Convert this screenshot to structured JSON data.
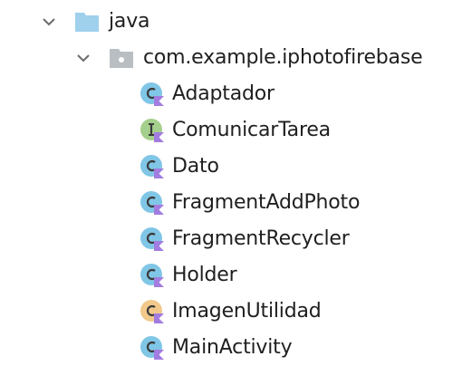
{
  "tree": {
    "java_folder": {
      "label": "java",
      "icon": "folder-icon",
      "color": "#9fd0ec",
      "expanded": true
    },
    "package": {
      "label": "com.example.iphotofirebase",
      "icon": "package-folder-icon",
      "color": "#b9bec3",
      "expanded": true
    },
    "classes": [
      {
        "label": "Adaptador",
        "icon": "kotlin-class-icon",
        "color": "#80c6e6"
      },
      {
        "label": "ComunicarTarea",
        "icon": "kotlin-interface-icon",
        "color": "#a5cf8c"
      },
      {
        "label": "Dato",
        "icon": "kotlin-class-icon",
        "color": "#80c6e6"
      },
      {
        "label": "FragmentAddPhoto",
        "icon": "kotlin-class-icon",
        "color": "#80c6e6"
      },
      {
        "label": "FragmentRecycler",
        "icon": "kotlin-class-icon",
        "color": "#80c6e6"
      },
      {
        "label": "Holder",
        "icon": "kotlin-class-icon",
        "color": "#80c6e6"
      },
      {
        "label": "ImagenUtilidad",
        "icon": "kotlin-object-icon",
        "color": "#f1c98b"
      },
      {
        "label": "MainActivity",
        "icon": "kotlin-class-icon",
        "color": "#80c6e6"
      }
    ],
    "kotlin_badge_color": "#a27ce0"
  }
}
